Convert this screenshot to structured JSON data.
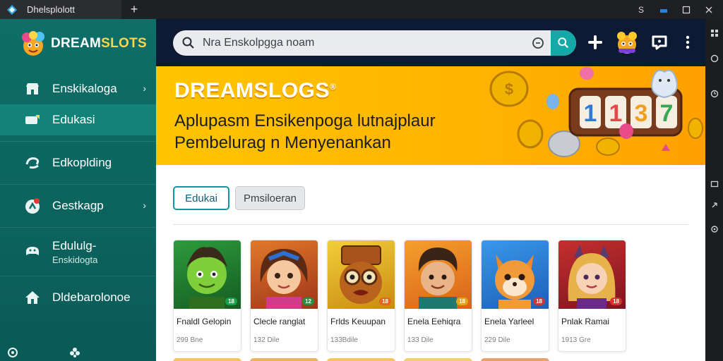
{
  "window": {
    "tab_title": "Dhelsplolott",
    "new_tab_label": "+",
    "controls": [
      "S",
      "—",
      "☐",
      "✕"
    ]
  },
  "sidebar": {
    "brand": {
      "part1": "DREAM",
      "part2": "SLOTS"
    },
    "items": [
      {
        "label": "Enskikaloga",
        "icon": "shop-icon",
        "has_arrow": true,
        "active": false
      },
      {
        "label": "Edukasi",
        "icon": "chat-card-icon",
        "has_arrow": false,
        "active": true
      },
      {
        "label": "Edkoplding",
        "icon": "swirl-icon",
        "has_arrow": false,
        "active": false
      },
      {
        "label": "Gestkagp",
        "icon": "badge-icon",
        "has_arrow": true,
        "active": false
      },
      {
        "label": "Edululg-",
        "sublabel": "Enskidogta",
        "icon": "game-pad-icon",
        "has_arrow": false,
        "active": false
      },
      {
        "label": "Dldebarolonoe",
        "icon": "house-icon",
        "has_arrow": false,
        "active": false
      }
    ]
  },
  "topbar": {
    "search_value": "",
    "search_placeholder": "Nra Enskolpgga noam"
  },
  "banner": {
    "title": "DREAMSLOGS",
    "title_mark": "®",
    "line1": "Aplupasm Ensikenpoga lutnajplaur",
    "line2": "Pembelurag n Menyenankan"
  },
  "filters": {
    "active": "Edukai",
    "other": "Pmsiloeran"
  },
  "cards": [
    {
      "title": "Fnaldl Gelopin",
      "meta": "299 Bne",
      "badge": "18",
      "badge_color": "#17a34a",
      "bg": "#1f7a2e"
    },
    {
      "title": "Clecle ranglat",
      "meta": "132 Dile",
      "badge": "12",
      "badge_color": "#2d8a3e",
      "bg": "#c25a1e"
    },
    {
      "title": "Frlds Keuupan",
      "meta": "133Bdile",
      "badge": "18",
      "badge_color": "#e0671c",
      "bg": "#e3b42a"
    },
    {
      "title": "Enela Eehiqra",
      "meta": "133 Dile",
      "badge": "18",
      "badge_color": "#e5a51a",
      "bg": "#ee8a22"
    },
    {
      "title": "Enela Yarleel",
      "meta": "229 Dile",
      "badge": "18",
      "badge_color": "#c43b3b",
      "bg": "#2f8be0"
    },
    {
      "title": "Pnlak Ramai",
      "meta": "1913 Gre",
      "badge": "18",
      "badge_color": "#d2342e",
      "bg": "#b5232a"
    }
  ],
  "colors": {
    "sidebar": "#0e6f68",
    "topbar": "#0c1a34",
    "accent": "#14a9a7",
    "banner": "#ffc400"
  }
}
